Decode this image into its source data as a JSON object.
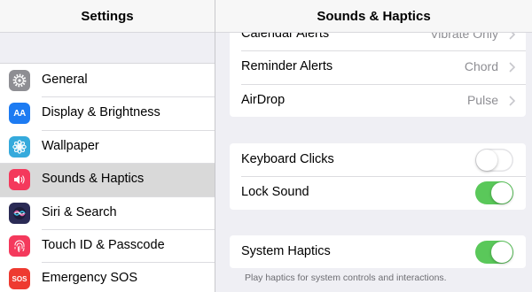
{
  "master": {
    "title": "Settings",
    "items": [
      {
        "label": "General",
        "icon": "gear-icon",
        "color": "#8e8e93",
        "selected": false
      },
      {
        "label": "Display & Brightness",
        "icon": "text-size-icon",
        "color": "#1d7bf2",
        "selected": false
      },
      {
        "label": "Wallpaper",
        "icon": "flower-icon",
        "color": "#35aadc",
        "selected": false
      },
      {
        "label": "Sounds & Haptics",
        "icon": "speaker-icon",
        "color": "#f4395c",
        "selected": true
      },
      {
        "label": "Siri & Search",
        "icon": "siri-icon",
        "color": "#2a2a55",
        "selected": false
      },
      {
        "label": "Touch ID & Passcode",
        "icon": "fingerprint-icon",
        "color": "#f4395c",
        "selected": false
      },
      {
        "label": "Emergency SOS",
        "icon": "sos-icon",
        "color": "#ee3a30",
        "selected": false
      }
    ],
    "icon_text": {
      "display": "AA",
      "sos": "SOS"
    }
  },
  "detail": {
    "title": "Sounds & Haptics",
    "alerts": [
      {
        "label": "Calendar Alerts",
        "value": "Vibrate Only"
      },
      {
        "label": "Reminder Alerts",
        "value": "Chord"
      },
      {
        "label": "AirDrop",
        "value": "Pulse"
      }
    ],
    "toggles": [
      {
        "label": "Keyboard Clicks",
        "on": false
      },
      {
        "label": "Lock Sound",
        "on": true
      }
    ],
    "haptics": {
      "label": "System Haptics",
      "on": true
    },
    "footnote": "Play haptics for system controls and interactions."
  },
  "colors": {
    "switch_on": "#5ac85a",
    "secondary_text": "#8e8e93",
    "background": "#efeff4"
  }
}
